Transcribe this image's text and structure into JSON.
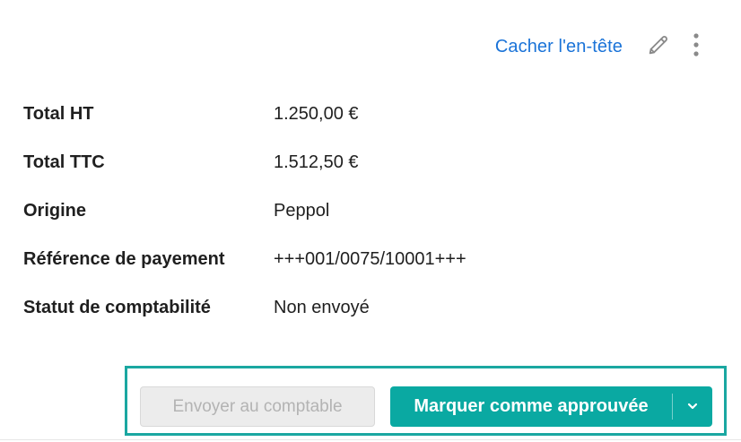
{
  "header": {
    "hide_header_label": "Cacher l'en-tête",
    "edit_icon": "pencil-icon",
    "more_icon": "more-vertical-icon"
  },
  "details": [
    {
      "label": "Total HT",
      "value": "1.250,00 €"
    },
    {
      "label": "Total TTC",
      "value": "1.512,50 €"
    },
    {
      "label": "Origine",
      "value": "Peppol"
    },
    {
      "label": "Référence de payement",
      "value": "+++001/0075/10001+++"
    },
    {
      "label": "Statut de comptabilité",
      "value": "Non envoyé"
    }
  ],
  "actions": {
    "send_to_accountant_label": "Envoyer au comptable",
    "mark_approved_label": "Marquer comme approuvée",
    "dropdown_icon": "chevron-down-icon"
  },
  "colors": {
    "accent": "#0aa9a2",
    "highlight_border": "#1aa7a1",
    "link": "#1a73d8",
    "disabled_bg": "#ececec",
    "disabled_text": "#b3b3b3"
  }
}
